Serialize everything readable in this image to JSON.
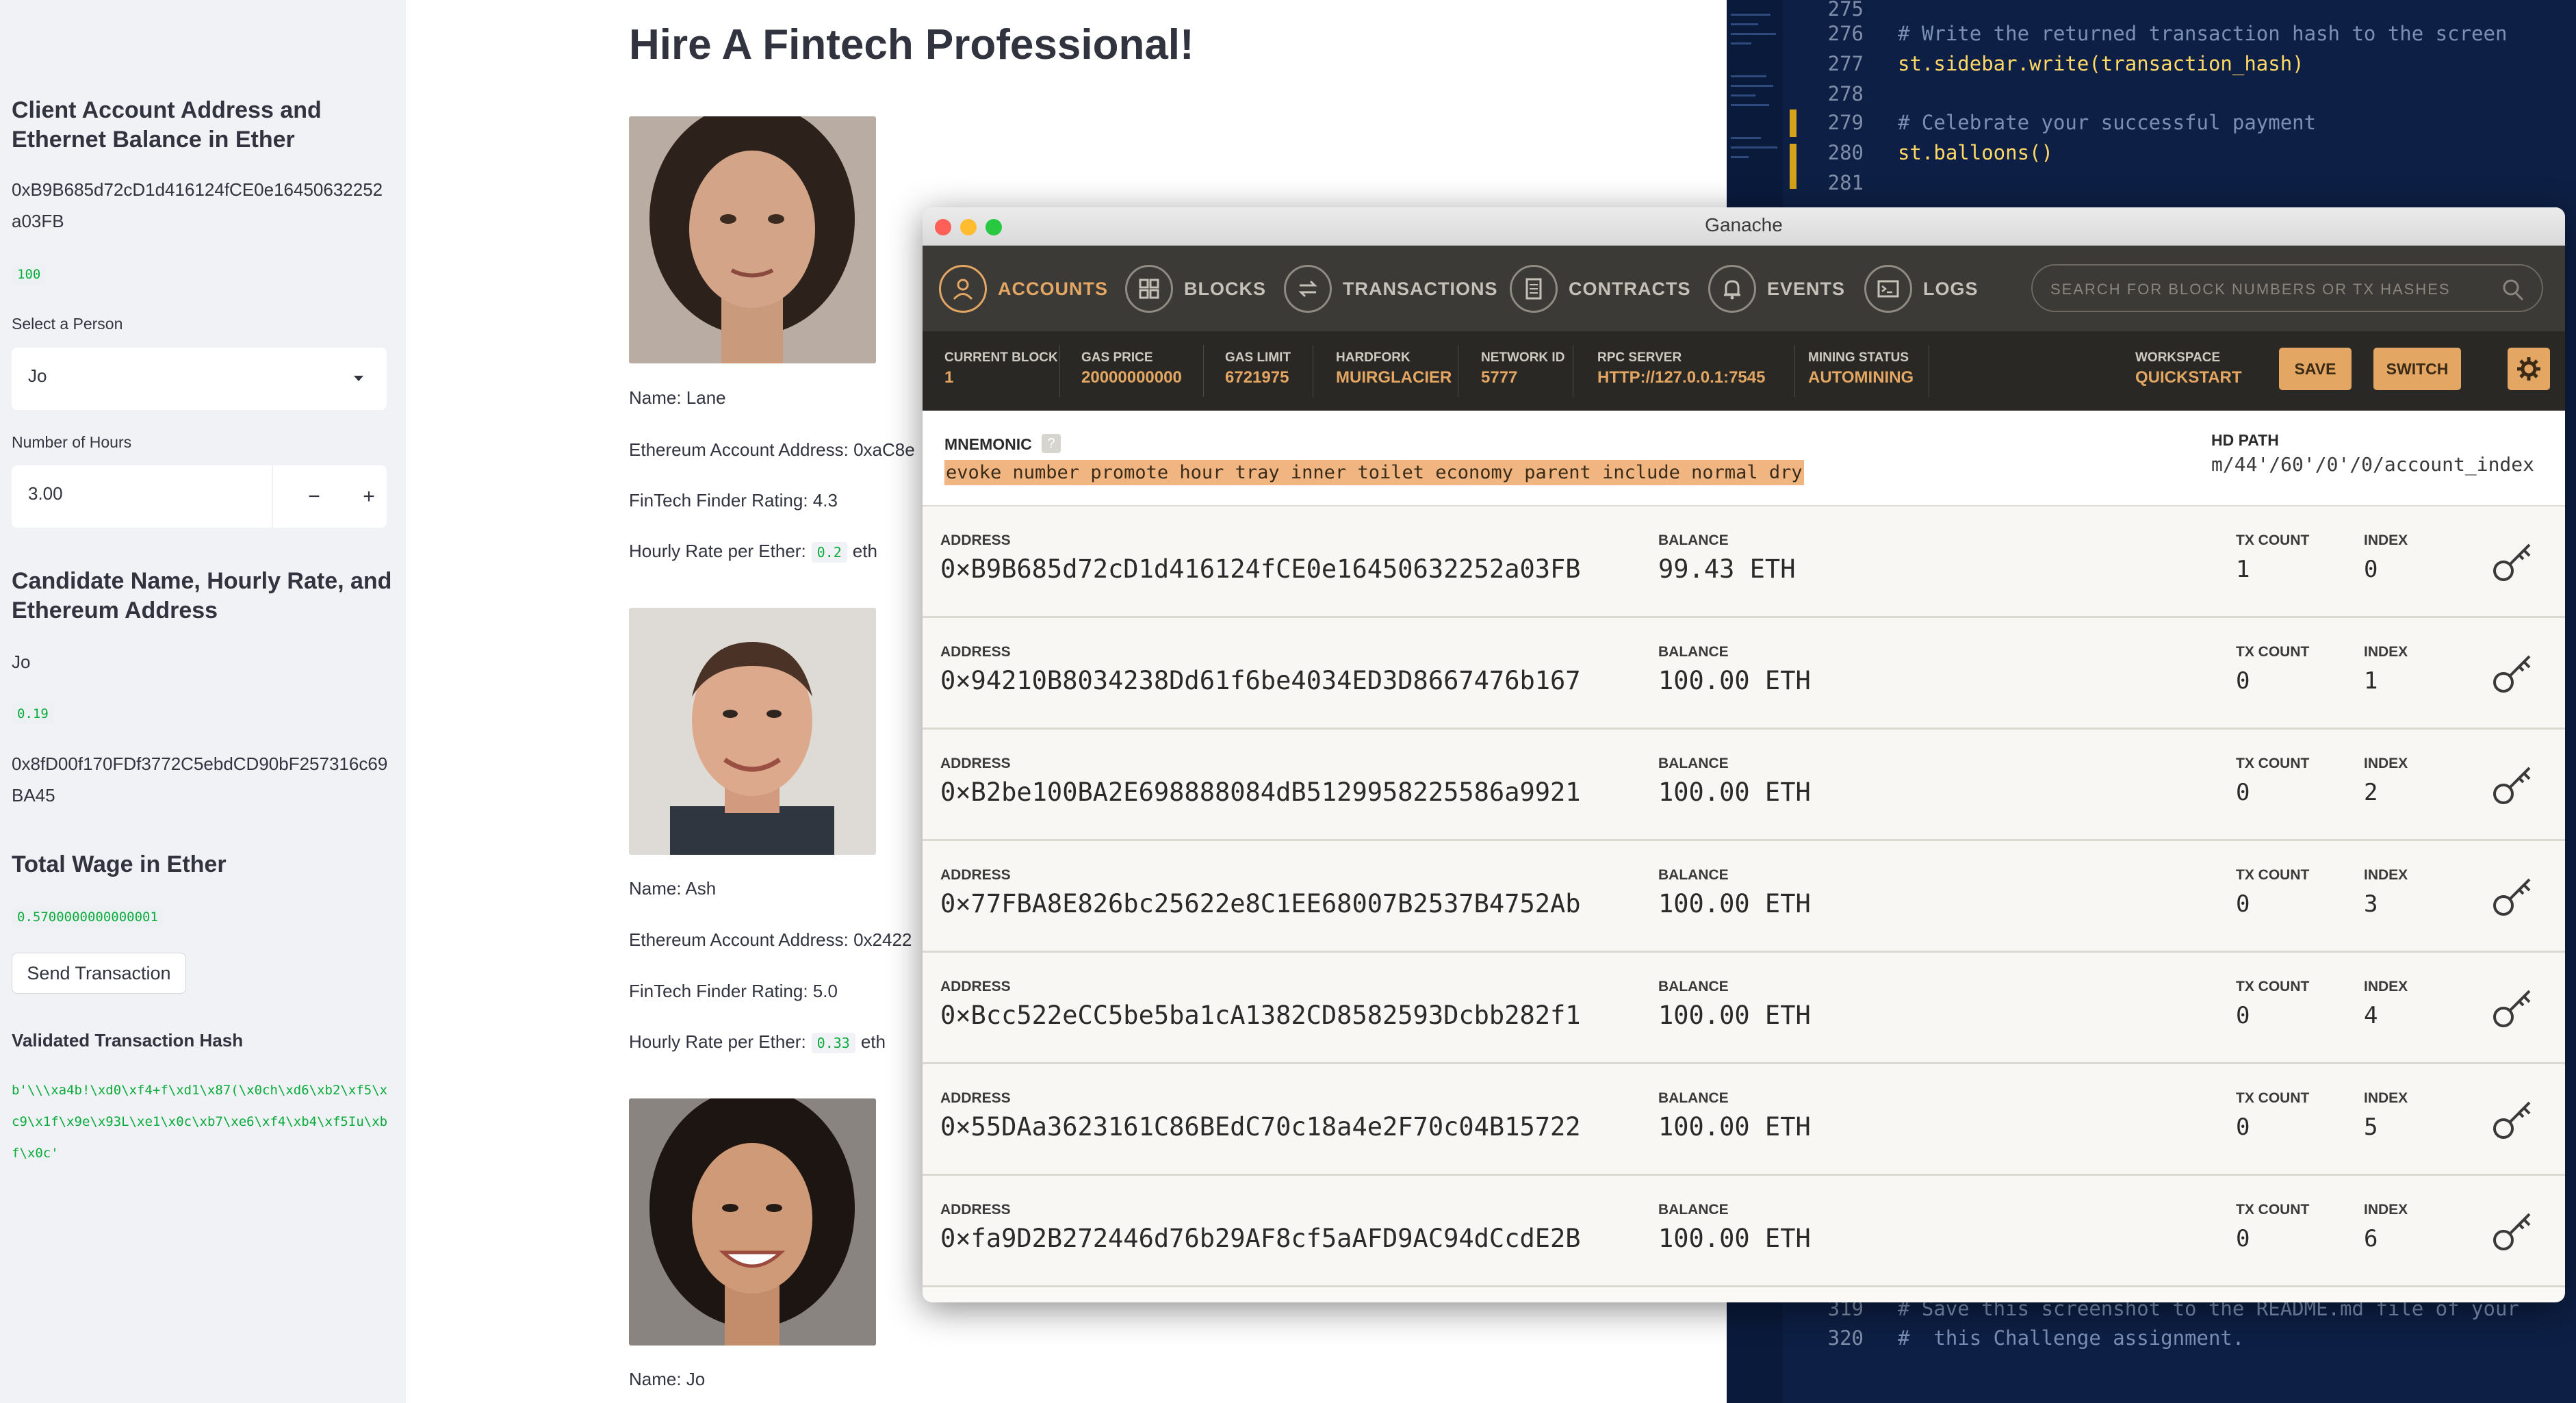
{
  "sidebar": {
    "client_heading": "Client Account Address and Ethernet Balance in Ether",
    "client_address_line1": "0xB9B685d72cD1d416124fCE0e16450632252",
    "client_address_line2": "a03FB",
    "client_balance": "100",
    "select_label": "Select a Person",
    "select_value": "Jo",
    "hours_label": "Number of Hours",
    "hours_value": "3.00",
    "minus_label": "−",
    "plus_label": "+",
    "candidate_heading": "Candidate Name, Hourly Rate, and Ethereum Address",
    "candidate_name": "Jo",
    "candidate_rate": "0.19",
    "candidate_address_line1": "0x8fD00f170FDf3772C5ebdCD90bF257316c69",
    "candidate_address_line2": "BA45",
    "wage_heading": "Total Wage in Ether",
    "wage_value": "0.5700000000000001",
    "send_button": "Send Transaction",
    "hash_heading": "Validated Transaction Hash",
    "hash_value": "b'\\\\\\xa4b!\\xd0\\xf4+f\\xd1\\x87(\\x0ch\\xd6\\xb2\\xf5\\xc9\\x1f\\x9e\\x93L\\xe1\\x0c\\xb7\\xe6\\xf4\\xb4\\xf5Iu\\xbf\\x0c'"
  },
  "main": {
    "title": "Hire A Fintech Professional!",
    "candidates": [
      {
        "name": "Name: Lane",
        "address": "Ethereum Account Address: 0xaC8e",
        "rating": "FinTech Finder Rating: 4.3",
        "rate_label": "Hourly Rate per Ether:",
        "rate": "0.2",
        "unit": "eth"
      },
      {
        "name": "Name: Ash",
        "address": "Ethereum Account Address: 0x2422",
        "rating": "FinTech Finder Rating: 5.0",
        "rate_label": "Hourly Rate per Ether:",
        "rate": "0.33",
        "unit": "eth"
      },
      {
        "name": "Name: Jo"
      }
    ]
  },
  "editor": {
    "lines": [
      {
        "n": "275",
        "code": ""
      },
      {
        "n": "276",
        "code": "# Write the returned transaction hash to the screen"
      },
      {
        "n": "277",
        "code": "st.sidebar.write(transaction_hash)"
      },
      {
        "n": "278",
        "code": ""
      },
      {
        "n": "279",
        "code": "# Celebrate your successful payment"
      },
      {
        "n": "280",
        "code": "st.balloons()"
      },
      {
        "n": "281",
        "code": ""
      },
      {
        "n": "319",
        "code": "# Save this screenshot to the README.md file of your"
      },
      {
        "n": "320",
        "code": "#  this Challenge assignment."
      }
    ]
  },
  "ganache": {
    "window_title": "Ganache",
    "nav": [
      "ACCOUNTS",
      "BLOCKS",
      "TRANSACTIONS",
      "CONTRACTS",
      "EVENTS",
      "LOGS"
    ],
    "search_placeholder": "SEARCH FOR BLOCK NUMBERS OR TX HASHES",
    "status": {
      "current_block_label": "CURRENT BLOCK",
      "current_block": "1",
      "gas_price_label": "GAS PRICE",
      "gas_price": "20000000000",
      "gas_limit_label": "GAS LIMIT",
      "gas_limit": "6721975",
      "hardfork_label": "HARDFORK",
      "hardfork": "MUIRGLACIER",
      "network_id_label": "NETWORK ID",
      "network_id": "5777",
      "rpc_label": "RPC SERVER",
      "rpc": "HTTP://127.0.0.1:7545",
      "mining_label": "MINING STATUS",
      "mining": "AUTOMINING",
      "workspace_label": "WORKSPACE",
      "workspace": "QUICKSTART"
    },
    "save_button": "SAVE",
    "switch_button": "SWITCH",
    "mnemonic_label": "MNEMONIC",
    "mnemonic_help": "?",
    "mnemonic": "evoke number promote hour tray inner toilet economy parent include normal dry",
    "hd_path_label": "HD PATH",
    "hd_path": "m/44'/60'/0'/0/account_index",
    "col_address": "ADDRESS",
    "col_balance": "BALANCE",
    "col_tx_count": "TX COUNT",
    "col_index": "INDEX",
    "accounts": [
      {
        "address": "0×B9B685d72cD1d416124fCE0e16450632252a03FB",
        "balance": "99.43 ETH",
        "tx_count": "1",
        "index": "0"
      },
      {
        "address": "0×94210B8034238Dd61f6be4034ED3D8667476b167",
        "balance": "100.00 ETH",
        "tx_count": "0",
        "index": "1"
      },
      {
        "address": "0×B2be100BA2E698888084dB5129958225586a9921",
        "balance": "100.00 ETH",
        "tx_count": "0",
        "index": "2"
      },
      {
        "address": "0×77FBA8E826bc25622e8C1EE68007B2537B4752Ab",
        "balance": "100.00 ETH",
        "tx_count": "0",
        "index": "3"
      },
      {
        "address": "0×Bcc522eCC5be5ba1cA1382CD8582593Dcbb282f1",
        "balance": "100.00 ETH",
        "tx_count": "0",
        "index": "4"
      },
      {
        "address": "0×55DAa3623161C86BEdC70c18a4e2F70c04B15722",
        "balance": "100.00 ETH",
        "tx_count": "0",
        "index": "5"
      },
      {
        "address": "0×fa9D2B272446d76b29AF8cf5aAFD9AC94dCcdE2B",
        "balance": "100.00 ETH",
        "tx_count": "0",
        "index": "6"
      }
    ],
    "colors": {
      "accent": "#e4a663",
      "nav_bg": "#3b3a36",
      "status_bg": "#292824"
    }
  }
}
